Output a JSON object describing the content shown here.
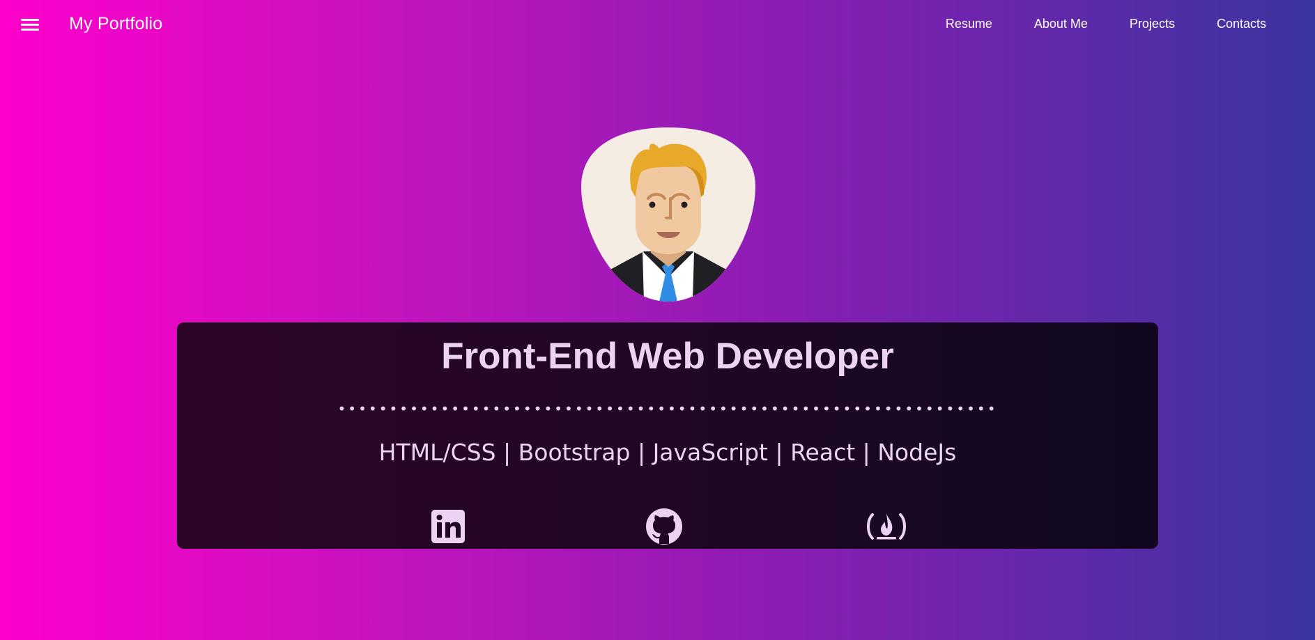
{
  "nav": {
    "brand": "My Portfolio",
    "links": [
      "Resume",
      "About Me",
      "Projects",
      "Contacts"
    ],
    "menu_icon": "hamburger-menu-icon"
  },
  "hero": {
    "avatar_icon": "developer-avatar-illustration",
    "title": "Front-End Web Developer",
    "divider": "••••••••••••••••••••••••••••••••••••••••••••••••••••••••••••••••",
    "skills": "HTML/CSS | Bootstrap | JavaScript | React | NodeJs",
    "social": [
      {
        "icon": "linkedin-icon"
      },
      {
        "icon": "github-icon"
      },
      {
        "icon": "freecodecamp-icon"
      }
    ]
  },
  "colors": {
    "gradient_start": "#ff00cc",
    "gradient_end": "#3a34a0",
    "card_bg": "#200726",
    "text": "#ecd3f3"
  }
}
